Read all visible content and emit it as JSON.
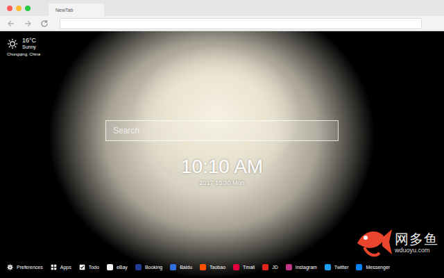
{
  "window": {
    "tab_title": "NewTab"
  },
  "weather": {
    "temperature": "16°C",
    "condition": "Sunny",
    "location": "Chongqing, China"
  },
  "search": {
    "placeholder": "Search"
  },
  "clock": {
    "time": "10:10 AM",
    "date": "2017 10.30 Mon"
  },
  "shortcuts": [
    {
      "label": "Preferences",
      "kind": "gear",
      "color": "#ffffff"
    },
    {
      "label": "Apps",
      "kind": "grid",
      "color": "#ffffff"
    },
    {
      "label": "Todo",
      "kind": "check",
      "color": "#ffffff"
    },
    {
      "label": "eBay",
      "kind": "site",
      "color": "#f4f4f4"
    },
    {
      "label": "Booking",
      "kind": "site",
      "color": "#1f3b8f"
    },
    {
      "label": "Baidu",
      "kind": "site",
      "color": "#2f6fe0"
    },
    {
      "label": "Taobao",
      "kind": "site",
      "color": "#ff5000"
    },
    {
      "label": "Tmall",
      "kind": "site",
      "color": "#e4003a"
    },
    {
      "label": "JD",
      "kind": "site",
      "color": "#e1251b"
    },
    {
      "label": "Instagram",
      "kind": "site",
      "color": "#c13584"
    },
    {
      "label": "Twitter",
      "kind": "site",
      "color": "#1da1f2"
    },
    {
      "label": "Messenger",
      "kind": "site",
      "color": "#0084ff"
    }
  ],
  "watermark": {
    "brand": "网多鱼",
    "url": "wduoyu.com"
  }
}
